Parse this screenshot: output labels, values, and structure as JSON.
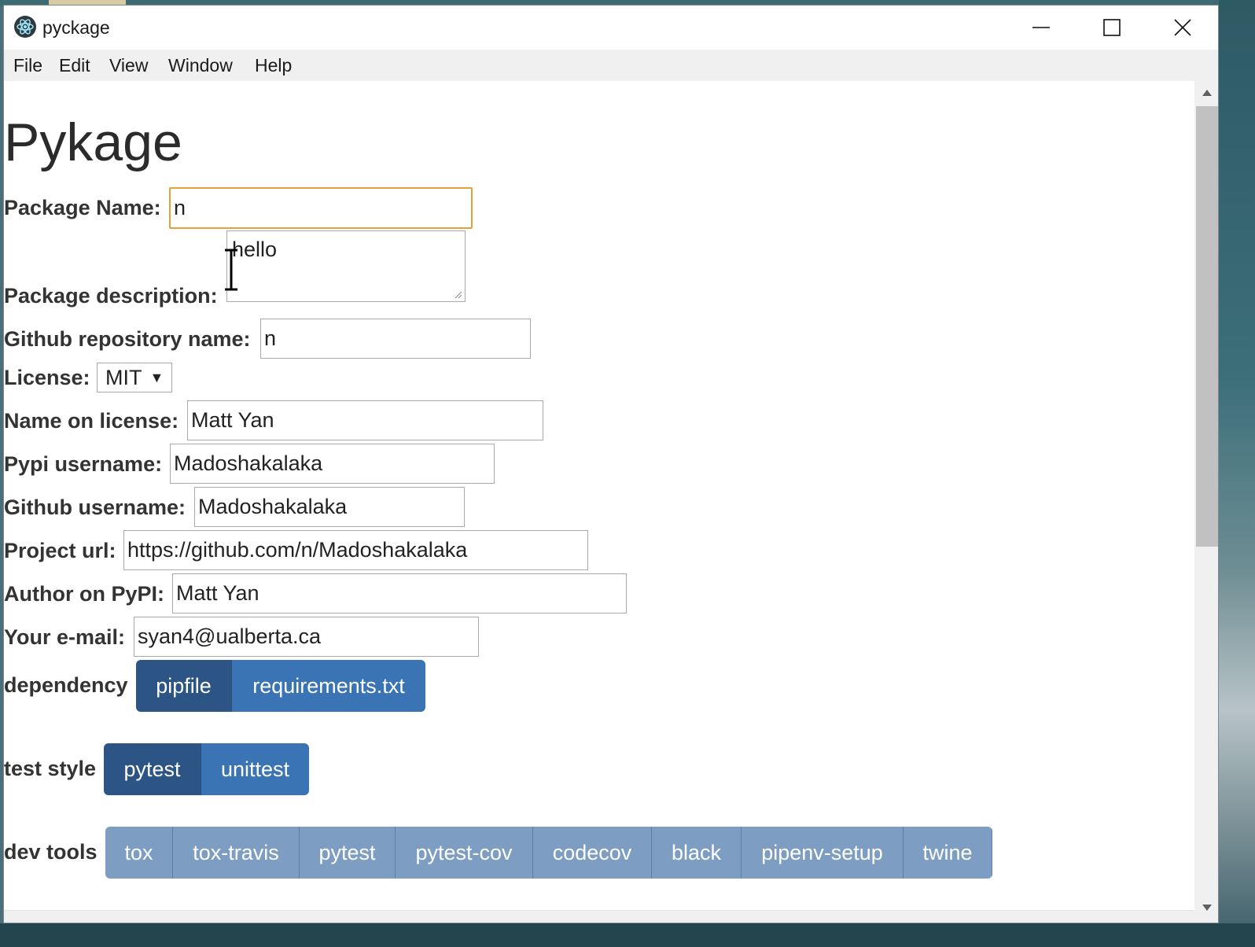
{
  "window": {
    "title": "pyckage"
  },
  "menu": [
    "File",
    "Edit",
    "View",
    "Window",
    "Help"
  ],
  "page": {
    "title": "Pykage"
  },
  "form": {
    "package_name": {
      "label": "Package Name:",
      "value": "n"
    },
    "package_description": {
      "label": "Package description:",
      "value": "hello"
    },
    "github_repo": {
      "label": "Github repository name:",
      "value": "n"
    },
    "license": {
      "label": "License:",
      "value": "MIT"
    },
    "name_on_license": {
      "label": "Name on license:",
      "value": "Matt Yan"
    },
    "pypi_username": {
      "label": "Pypi username:",
      "value": "Madoshakalaka"
    },
    "github_username": {
      "label": "Github username:",
      "value": "Madoshakalaka"
    },
    "project_url": {
      "label": "Project url:",
      "value": "https://github.com/n/Madoshakalaka"
    },
    "author_pypi": {
      "label": "Author on PyPI:",
      "value": "Matt Yan"
    },
    "email": {
      "label": "Your e-mail:",
      "value": "syan4@ualberta.ca"
    }
  },
  "dependency": {
    "label": "dependency",
    "options": [
      "pipfile",
      "requirements.txt"
    ],
    "selected": "pipfile"
  },
  "test_style": {
    "label": "test style",
    "options": [
      "pytest",
      "unittest"
    ],
    "selected": "pytest"
  },
  "dev_tools": {
    "label": "dev tools",
    "options": [
      "tox",
      "tox-travis",
      "pytest",
      "pytest-cov",
      "codecov",
      "black",
      "pipenv-setup",
      "twine"
    ]
  },
  "colors": {
    "focus_border": "#e4a23a",
    "active_segment": "#2c5485",
    "segment": "#3a74b4",
    "dev_segment": "#7d9ec2"
  }
}
